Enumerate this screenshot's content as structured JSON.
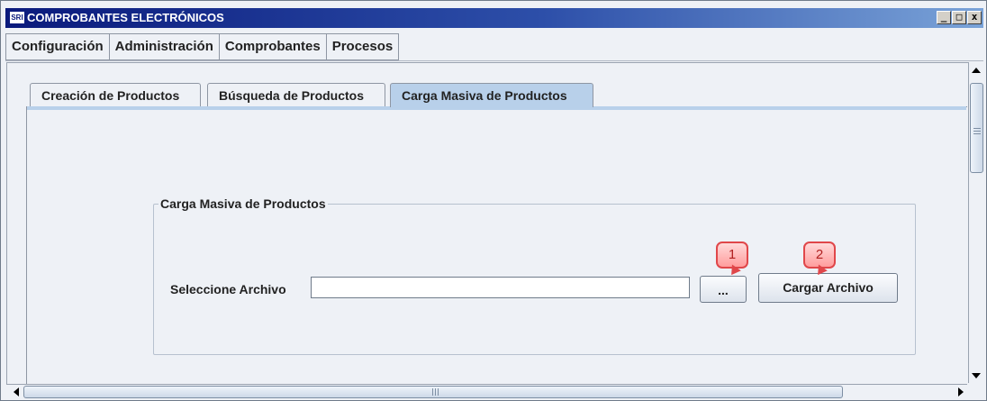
{
  "window": {
    "app_icon_text": "SRI",
    "title": "COMPROBANTES ELECTRÓNICOS",
    "minimize": "_",
    "maximize": "□",
    "close": "x"
  },
  "menubar": {
    "items": [
      {
        "label": "Configuración"
      },
      {
        "label": "Administración"
      },
      {
        "label": "Comprobantes"
      },
      {
        "label": "Procesos"
      }
    ]
  },
  "tabs": [
    {
      "label": "Creación de Productos",
      "active": false
    },
    {
      "label": "Búsqueda de Productos",
      "active": false
    },
    {
      "label": "Carga Masiva de Productos",
      "active": true
    }
  ],
  "group": {
    "title": "Carga Masiva de Productos",
    "file_label": "Seleccione Archivo",
    "file_value": "",
    "browse_label": "...",
    "load_label": "Cargar Archivo"
  },
  "callouts": [
    {
      "number": "1"
    },
    {
      "number": "2"
    }
  ],
  "colors": {
    "titlebar_start": "#0a1a7c",
    "titlebar_end": "#7aa3d8",
    "active_tab": "#b8d0ea",
    "callout_border": "#e0474a",
    "callout_fill": "#ff9d9d"
  }
}
